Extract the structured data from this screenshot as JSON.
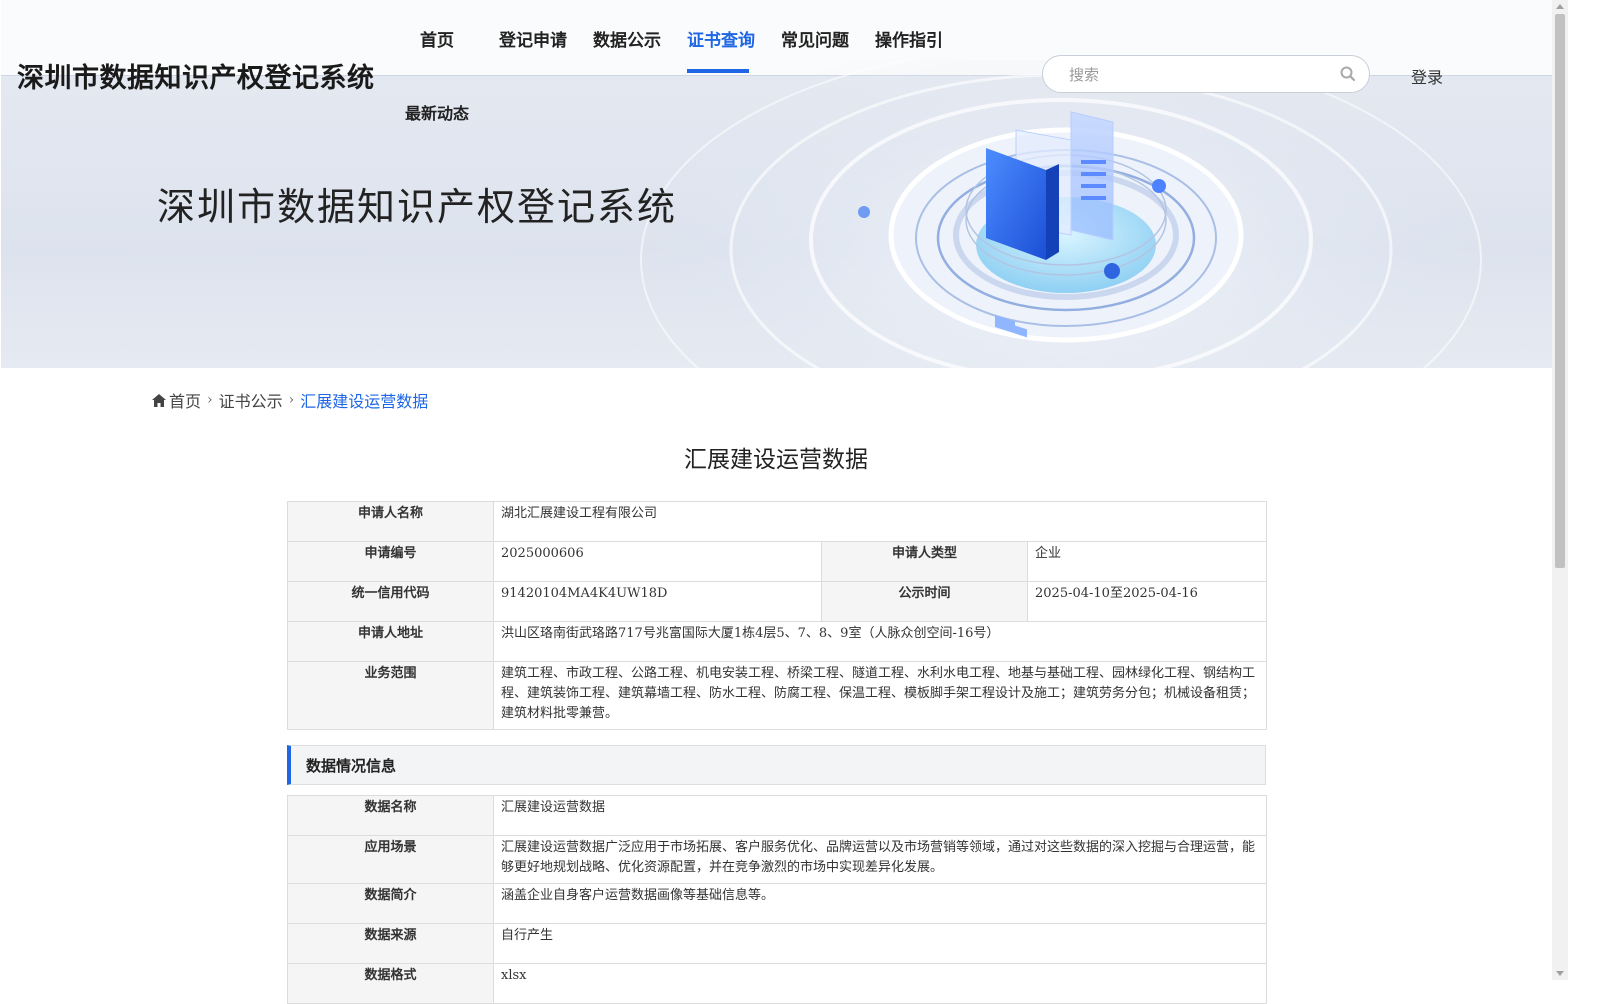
{
  "site": {
    "logo": "深圳市数据知识产权登记系统"
  },
  "nav": {
    "items": [
      {
        "label": "首页"
      },
      {
        "label": "登记申请"
      },
      {
        "label": "数据公示"
      },
      {
        "label": "证书查询",
        "active": true
      },
      {
        "label": "常见问题"
      },
      {
        "label": "操作指引"
      },
      {
        "label": "最新动态"
      }
    ]
  },
  "search": {
    "placeholder": "搜索",
    "icon": "search-icon"
  },
  "login": "登录",
  "banner": {
    "title": "深圳市数据知识产权登记系统"
  },
  "breadcrumb": {
    "home": "首页",
    "level2": "证书公示",
    "current": "汇展建设运营数据"
  },
  "page_title": "汇展建设运营数据",
  "applicant": {
    "name_label": "申请人名称",
    "name": "湖北汇展建设工程有限公司",
    "no_label": "申请编号",
    "no": "2025000606",
    "type_label": "申请人类型",
    "type": "企业",
    "credit_label": "统一信用代码",
    "credit": "91420104MA4K4UW18D",
    "pubtime_label": "公示时间",
    "pubtime": "2025-04-10至2025-04-16",
    "addr_label": "申请人地址",
    "addr": "洪山区珞南街武珞路717号兆富国际大厦1栋4层5、7、8、9室（人脉众创空间-16号）",
    "scope_label": "业务范围",
    "scope": "建筑工程、市政工程、公路工程、机电安装工程、桥梁工程、隧道工程、水利水电工程、地基与基础工程、园林绿化工程、钢结构工程、建筑装饰工程、建筑幕墙工程、防水工程、防腐工程、保温工程、模板脚手架工程设计及施工；建筑劳务分包；机械设备租赁；建筑材料批零兼营。"
  },
  "data_section": {
    "heading": "数据情况信息",
    "rows": [
      {
        "label": "数据名称",
        "value": "汇展建设运营数据"
      },
      {
        "label": "应用场景",
        "value": "汇展建设运营数据广泛应用于市场拓展、客户服务优化、品牌运营以及市场营销等领域，通过对这些数据的深入挖掘与合理运营，能够更好地规划战略、优化资源配置，并在竞争激烈的市场中实现差异化发展。"
      },
      {
        "label": "数据简介",
        "value": "涵盖企业自身客户运营数据画像等基础信息等。"
      },
      {
        "label": "数据来源",
        "value": "自行产生"
      },
      {
        "label": "数据格式",
        "value": "xlsx"
      }
    ]
  },
  "colors": {
    "accent": "#1f66e5"
  }
}
